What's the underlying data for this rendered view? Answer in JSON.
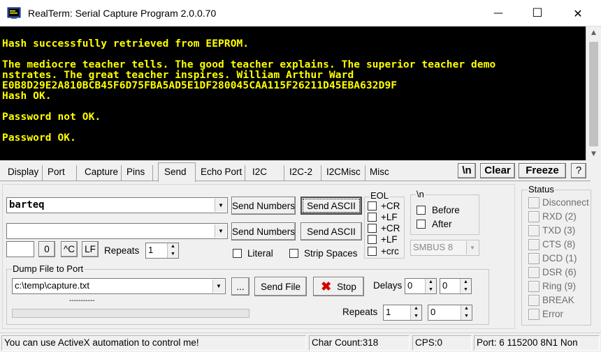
{
  "window": {
    "title": "RealTerm: Serial Capture Program 2.0.0.70",
    "minimize_glyph": "—",
    "maximize_glyph": "☐",
    "close_glyph": "✕"
  },
  "terminal": {
    "lines": [
      "Hash successfully retrieved from EEPROM.",
      "The mediocre teacher tells. The good teacher explains. The superior teacher demo",
      "nstrates. The great teacher inspires. William Arthur Ward",
      "E0B8D29E2A810BCB45F6D75FBA5AD5E1DF280045CAA115F26211D45EBA632D9F",
      "Hash OK.",
      "Password not OK.",
      "Password OK."
    ],
    "text_color": "#ffff00",
    "background": "#000000"
  },
  "tabs": [
    {
      "label": "Display"
    },
    {
      "label": "Port"
    },
    {
      "label": "Capture"
    },
    {
      "label": "Pins"
    },
    {
      "label": "Send"
    },
    {
      "label": "Echo Port"
    },
    {
      "label": "I2C"
    },
    {
      "label": "I2C-2"
    },
    {
      "label": "I2CMisc"
    },
    {
      "label": "Misc"
    }
  ],
  "tab_buttons": {
    "newline": "\\n",
    "clear": "Clear",
    "freeze": "Freeze",
    "help": "?"
  },
  "send": {
    "line1_value": "barteq",
    "line2_value": "",
    "send_numbers": "Send Numbers",
    "send_ascii": "Send ASCII",
    "char_value": "",
    "zero_button": "0",
    "ctrl_c_button": "^C",
    "lf_button": "LF",
    "repeats_label": "Repeats",
    "repeats_value": "1",
    "literal_label": "Literal",
    "strip_spaces_label": "Strip Spaces",
    "eol_title": "EOL",
    "eol_options": [
      "+CR",
      "+LF",
      "+CR",
      "+LF",
      "+crc"
    ],
    "nl_title": "\\n",
    "before_label": "Before",
    "after_label": "After",
    "smbus_value": "SMBUS 8"
  },
  "dump": {
    "title": "Dump File to Port",
    "file_value": "c:\\temp\\capture.txt",
    "browse_label": "...",
    "send_file_label": "Send File",
    "stop_label": "Stop",
    "delays_label": "Delays",
    "delay1_value": "0",
    "delay2_value": "0",
    "progress_text": "-----------",
    "repeats_label": "Repeats",
    "repeats1_value": "1",
    "repeats2_value": "0"
  },
  "status_panel": {
    "title": "Status",
    "items": [
      "Disconnect",
      "RXD (2)",
      "TXD (3)",
      "CTS (8)",
      "DCD (1)",
      "DSR (6)",
      "Ring (9)",
      "BREAK",
      "Error"
    ]
  },
  "statusbar": {
    "message": "You can use ActiveX automation to control me!",
    "char_count": "Char Count:318",
    "cps": "CPS:0",
    "port": "Port: 6 115200 8N1 Non"
  }
}
